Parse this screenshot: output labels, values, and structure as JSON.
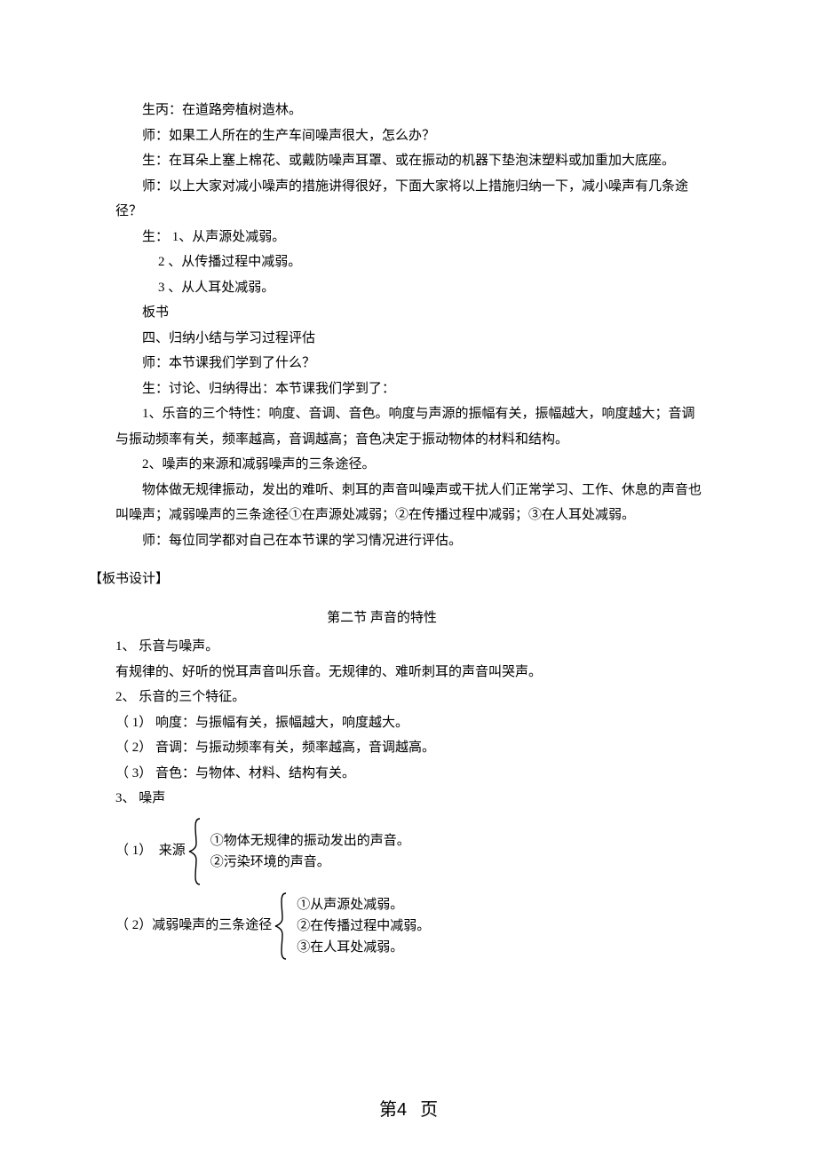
{
  "lines": {
    "l1": "生丙：在道路旁植树造林。",
    "l2": "师：如果工人所在的生产车间噪声很大，怎么办？",
    "l3": "生：在耳朵上塞上棉花、或戴防噪声耳罩、或在振动的机器下垫泡沫塑料或加重加大底座。",
    "l4": "师：以上大家对减小噪声的措施讲得很好，下面大家将以上措施归纳一下，减小噪声有几条途径？",
    "l5": "生： 1、从声源处减弱。",
    "l6": "2  、从传播过程中减弱。",
    "l7": "3  、从人耳处减弱。",
    "l8": "板书",
    "l9": "四、归纳小结与学习过程评估",
    "l10": "师：本节课我们学到了什么？",
    "l11": "生：讨论、归纳得出：本节课我们学到了：",
    "l12": "1、乐音的三个特性：响度、音调、音色。响度与声源的振幅有关，振幅越大，响度越大；音调与振动频率有关，频率越高，音调越高；音色决定于振动物体的材料和结构。",
    "l13": "2、噪声的来源和减弱噪声的三条途径。",
    "l14": "物体做无规律振动，发出的难听、刺耳的声音叫噪声或干扰人们正常学习、工作、休息的声音也叫噪声；减弱噪声的三条途径①在声源处减弱；②在传播过程中减弱；③在人耳处减弱。",
    "l15": "师：每位同学都对自己在本节课的学习情况进行评估。",
    "board_label": "【板书设计】",
    "title": "第二节 声音的特性",
    "b1": "1、 乐音与噪声。",
    "b2": "有规律的、好听的悦耳声音叫乐音。无规律的、难听刺耳的声音叫哭声。",
    "b3": "2、 乐音的三个特征。",
    "b4": "（ 1）  响度：与振幅有关，振幅越大，响度越大。",
    "b5": "（ 2）  音调：与振动频率有关，频率越高，音调越高。",
    "b6": "（ 3）  音色：与物体、材料、结构有关。",
    "b7": "3、 噪声",
    "src_label": "（ 1）  来源",
    "src1": "①物体无规律的振动发出的声音。",
    "src2": "②污染环境的声音。",
    "path_label": "（ 2）减弱噪声的三条途径",
    "p1": "①从声源处减弱。",
    "p2": "②在传播过程中减弱。",
    "p3": "③在人耳处减弱。"
  },
  "footer": {
    "prefix": "第",
    "num": "4",
    "suffix": "页"
  }
}
